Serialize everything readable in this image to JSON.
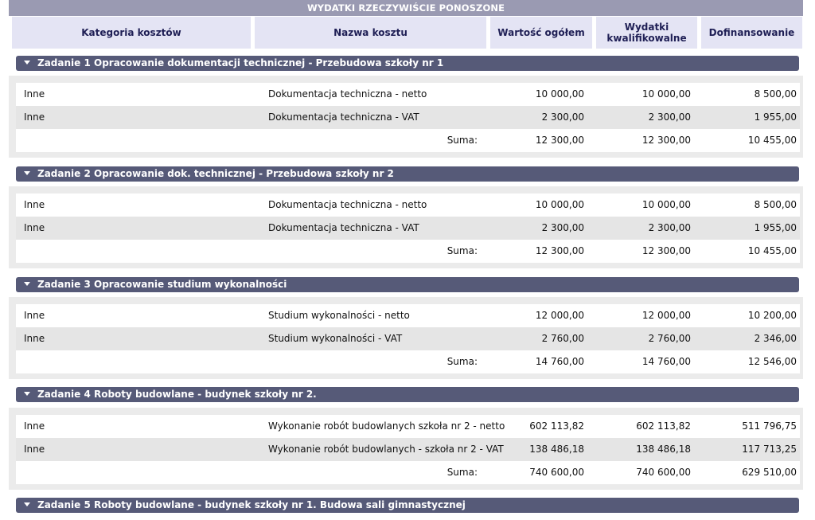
{
  "title": "WYDATKI RZECZYWIŚCIE PONOSZONE",
  "columns": {
    "category": "Kategoria kosztów",
    "name": "Nazwa kosztu",
    "total": "Wartość ogółem",
    "qualified": "Wydatki kwalifikowalne",
    "funding": "Dofinansowanie"
  },
  "tasks": [
    {
      "title": "Zadanie 1 Opracowanie dokumentacji technicznej - Przebudowa szkoły nr 1",
      "rows": [
        {
          "category": "Inne",
          "name": "Dokumentacja techniczna - netto",
          "total": "10 000,00",
          "qualified": "10 000,00",
          "funding": "8 500,00"
        },
        {
          "category": "Inne",
          "name": "Dokumentacja techniczna - VAT",
          "total": "2 300,00",
          "qualified": "2 300,00",
          "funding": "1 955,00"
        }
      ],
      "sum": {
        "label": "Suma:",
        "total": "12 300,00",
        "qualified": "12 300,00",
        "funding": "10 455,00"
      }
    },
    {
      "title": "Zadanie 2 Opracowanie dok. technicznej - Przebudowa szkoły nr 2",
      "rows": [
        {
          "category": "Inne",
          "name": "Dokumentacja techniczna - netto",
          "total": "10 000,00",
          "qualified": "10 000,00",
          "funding": "8 500,00"
        },
        {
          "category": "Inne",
          "name": "Dokumentacja techniczna - VAT",
          "total": "2 300,00",
          "qualified": "2 300,00",
          "funding": "1 955,00"
        }
      ],
      "sum": {
        "label": "Suma:",
        "total": "12 300,00",
        "qualified": "12 300,00",
        "funding": "10 455,00"
      }
    },
    {
      "title": "Zadanie 3 Opracowanie studium wykonalności",
      "rows": [
        {
          "category": "Inne",
          "name": "Studium wykonalności - netto",
          "total": "12 000,00",
          "qualified": "12 000,00",
          "funding": "10 200,00"
        },
        {
          "category": "Inne",
          "name": "Studium wykonalności - VAT",
          "total": "2 760,00",
          "qualified": "2 760,00",
          "funding": "2 346,00"
        }
      ],
      "sum": {
        "label": "Suma:",
        "total": "14 760,00",
        "qualified": "14 760,00",
        "funding": "12 546,00"
      }
    },
    {
      "title": "Zadanie 4 Roboty budowlane - budynek szkoły nr 2.",
      "rows": [
        {
          "category": "Inne",
          "name": "Wykonanie robót budowlanych szkoła nr 2 - netto",
          "total": "602 113,82",
          "qualified": "602 113,82",
          "funding": "511 796,75"
        },
        {
          "category": "Inne",
          "name": "Wykonanie robót budowlanych - szkoła nr 2 - VAT",
          "total": "138 486,18",
          "qualified": "138 486,18",
          "funding": "117 713,25"
        }
      ],
      "sum": {
        "label": "Suma:",
        "total": "740 600,00",
        "qualified": "740 600,00",
        "funding": "629 510,00"
      }
    },
    {
      "title": "Zadanie 5 Roboty budowlane - budynek szkoły nr 1. Budowa sali gimnastycznej"
    }
  ]
}
